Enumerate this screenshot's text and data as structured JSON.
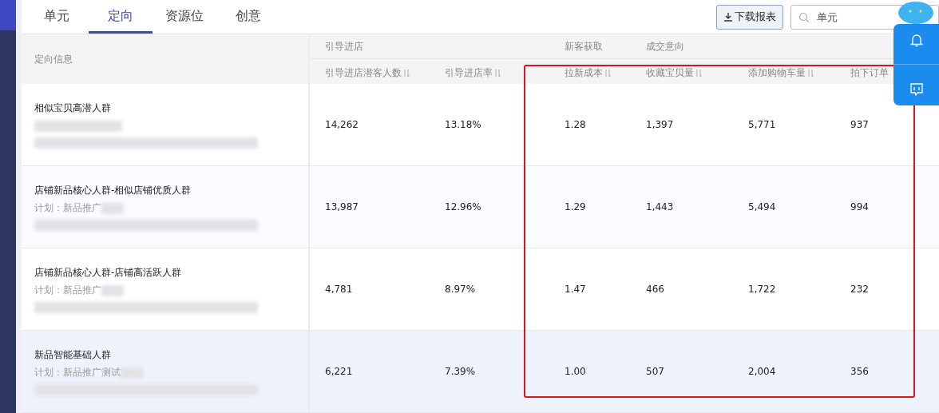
{
  "tabs": [
    {
      "label": "单元",
      "selected": false
    },
    {
      "label": "定向",
      "selected": true
    },
    {
      "label": "资源位",
      "selected": false
    },
    {
      "label": "创意",
      "selected": false
    }
  ],
  "download_button": "下载报表",
  "search": {
    "placeholder": "单元"
  },
  "table": {
    "first_column": "定向信息",
    "groups": [
      {
        "label": "引导进店"
      },
      {
        "label": "新客获取"
      },
      {
        "label": "成交意向"
      }
    ],
    "columns": [
      {
        "label": "引导进店潜客人数",
        "sortable": true
      },
      {
        "label": "引导进店率",
        "sortable": true
      },
      {
        "label": "拉新成本",
        "sortable": true
      },
      {
        "label": "收藏宝贝量",
        "sortable": true
      },
      {
        "label": "添加购物车量",
        "sortable": true
      },
      {
        "label": "拍下订单",
        "sortable": false
      }
    ],
    "rows": [
      {
        "name": "相似宝贝高潜人群",
        "values": [
          "14,262",
          "13.18%",
          "1.28",
          "1,397",
          "5,771",
          "937"
        ],
        "hovered": false
      },
      {
        "name": "店铺新品核心人群-相似店铺优质人群",
        "plan": "计划：新品推广",
        "values": [
          "13,987",
          "12.96%",
          "1.29",
          "1,443",
          "5,494",
          "994"
        ],
        "hovered": false
      },
      {
        "name": "店铺新品核心人群-店铺高活跃人群",
        "plan": "计划：新品推广",
        "values": [
          "4,781",
          "8.97%",
          "1.47",
          "466",
          "1,722",
          "232"
        ],
        "hovered": false
      },
      {
        "name": "新品智能基础人群",
        "plan": "计划：新品推广测试",
        "values": [
          "6,221",
          "7.39%",
          "1.00",
          "507",
          "2,004",
          "356"
        ],
        "hovered": true
      }
    ]
  }
}
